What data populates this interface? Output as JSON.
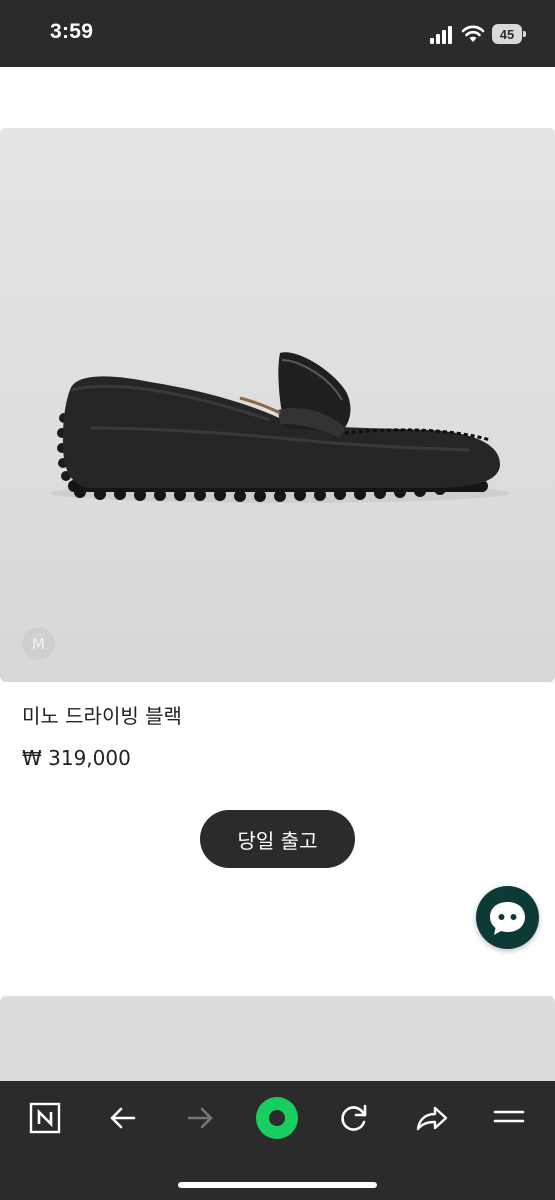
{
  "status_bar": {
    "time": "3:59",
    "battery": "45",
    "icons": [
      "signal-icon",
      "wifi-icon",
      "battery-icon"
    ]
  },
  "product": {
    "brand_badge": "M",
    "name": "미노 드라이빙 블랙",
    "price": "₩ 319,000",
    "image": "black-penny-loafer-driving-shoe"
  },
  "same_day_button": {
    "label": "당일 출고"
  },
  "chat_button": {
    "icon": "chat-bubble-icon",
    "color": "#0d3a36"
  },
  "browser_toolbar": {
    "items": [
      {
        "icon": "naver-logo-icon"
      },
      {
        "icon": "back-arrow-icon"
      },
      {
        "icon": "forward-arrow-icon",
        "enabled": false
      },
      {
        "icon": "green-dot-icon",
        "color": "#19ce60"
      },
      {
        "icon": "reload-icon"
      },
      {
        "icon": "share-icon"
      },
      {
        "icon": "menu-icon"
      }
    ]
  }
}
